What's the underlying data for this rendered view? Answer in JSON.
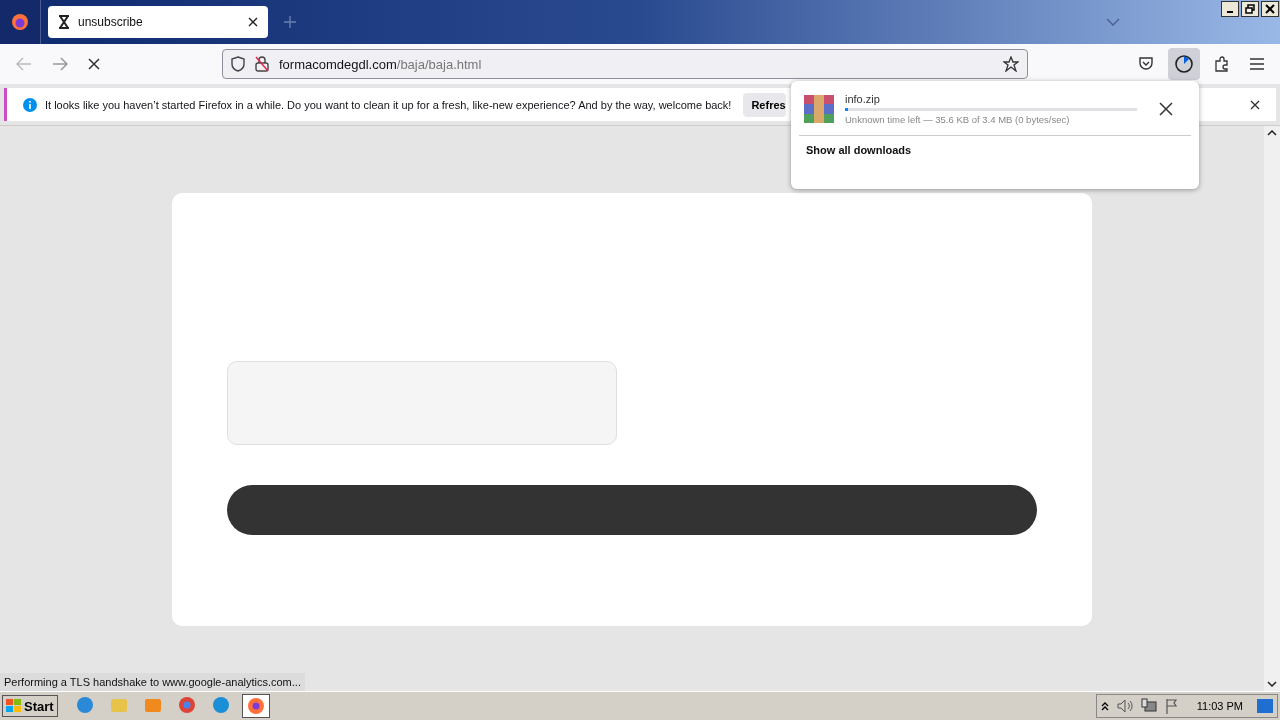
{
  "tabs": [
    {
      "title": "unsubscribe",
      "selected": true
    }
  ],
  "address": {
    "host": "formacomdegdl.com",
    "path": "/baja/baja.html"
  },
  "notification": {
    "message": "It looks like you haven’t started Firefox in a while. Do you want to clean it up for a fresh, like-new experience? And by the way, welcome back!",
    "button": "Refres"
  },
  "downloads_panel": {
    "items": [
      {
        "name": "info.zip",
        "level": 0.01,
        "status": "Unknown time left — 35.6 KB of 3.4 MB (0 bytes/sec)"
      }
    ],
    "footer": "Show all downloads"
  },
  "status_text": "Performing a TLS handshake to www.google-analytics.com...",
  "taskbar": {
    "start": "Start",
    "apps": [
      {
        "kind": "ie",
        "selected": false
      },
      {
        "kind": "folder",
        "selected": false
      },
      {
        "kind": "media",
        "selected": false
      },
      {
        "kind": "chrome",
        "selected": false
      },
      {
        "kind": "edge",
        "selected": false
      },
      {
        "kind": "firefox",
        "selected": true
      }
    ],
    "clock": "11:03 PM"
  }
}
